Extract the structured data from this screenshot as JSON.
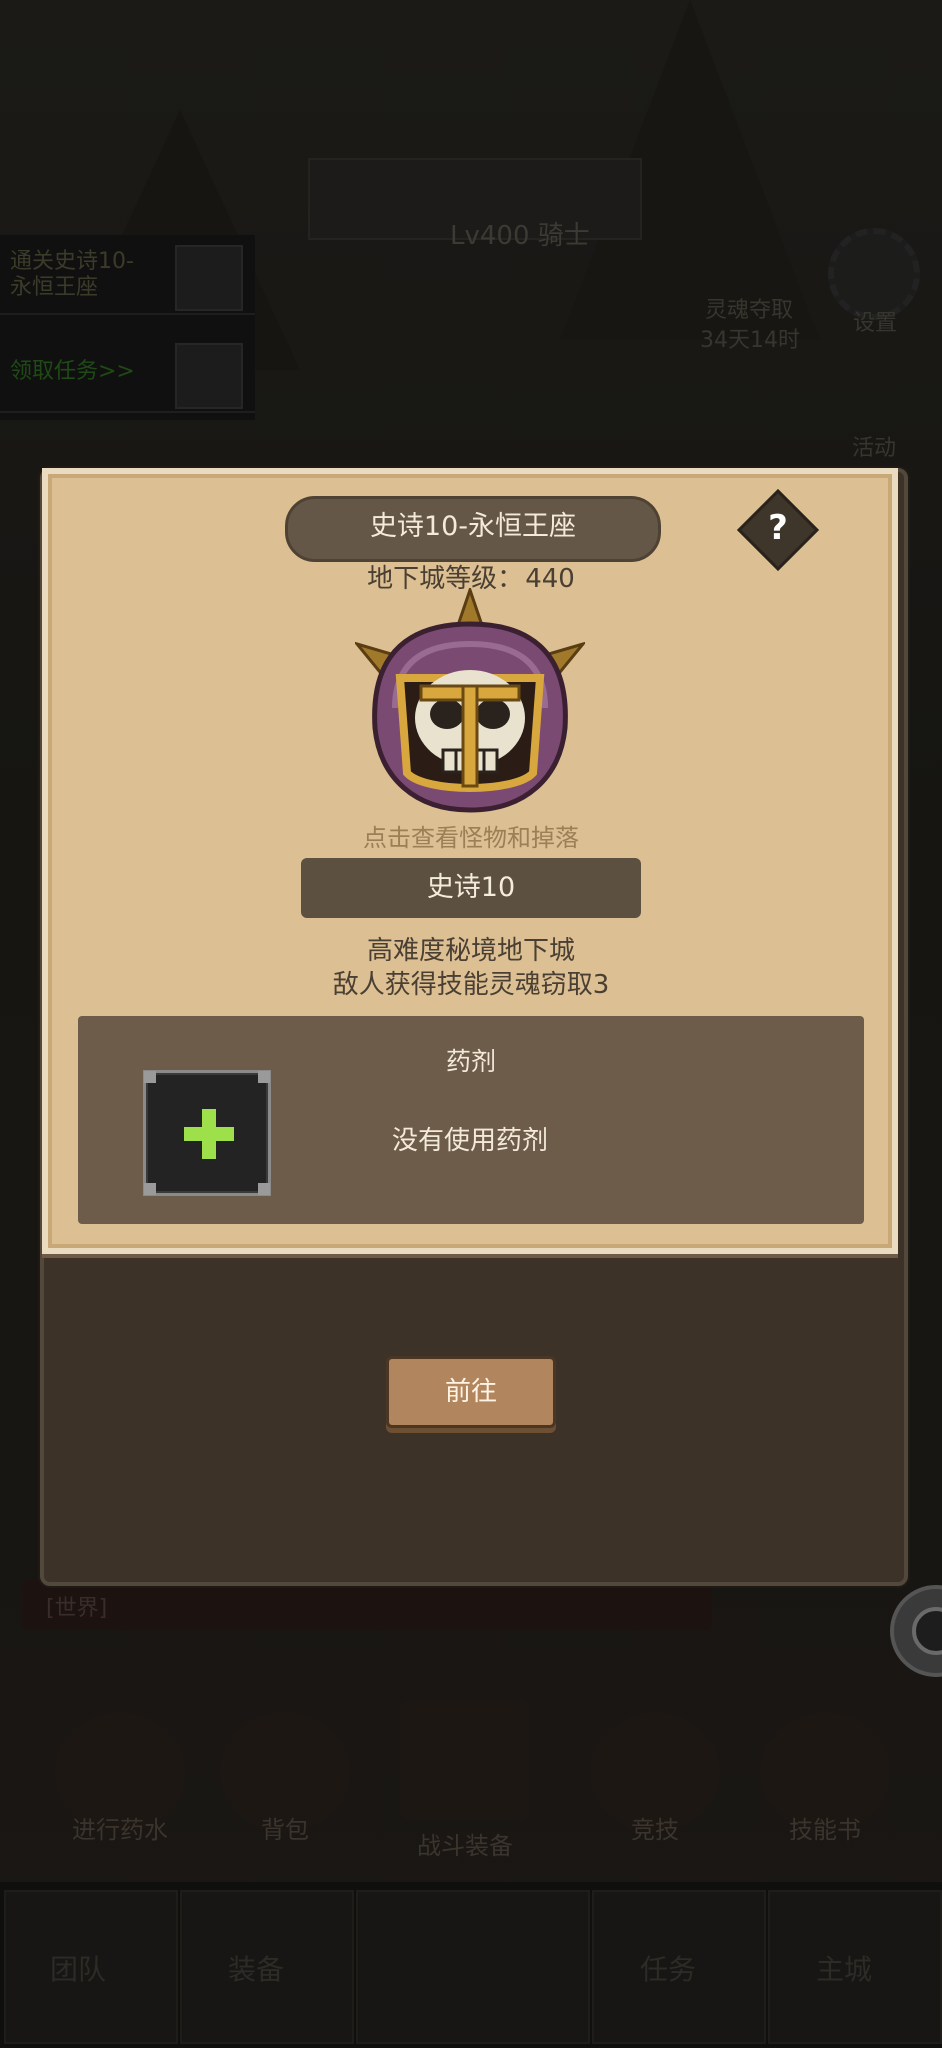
{
  "background": {
    "quest": {
      "line1": "通关史诗10-",
      "line2": "永恒王座",
      "link": "领取任务>>"
    },
    "top_text": "Lv400 骑士",
    "side_labels": {
      "settings": "设置",
      "countdown_title": "灵魂夺取",
      "countdown": "34天14时",
      "activity": "活动"
    },
    "chat_placeholder": "[世界]",
    "icons": [
      "进行药水",
      "背包",
      "战斗装备",
      "竞技",
      "技能书"
    ],
    "nav": [
      "团队",
      "装备",
      "",
      "任务",
      "主城"
    ]
  },
  "modal": {
    "title": "史诗10-永恒王座",
    "help_label": "?",
    "level_label": "地下城等级：",
    "level_value": "440",
    "boss_icon": "skull-helmet-icon",
    "hint": "点击查看怪物和掉落",
    "difficulty_button": "史诗10",
    "desc_line1": "高难度秘境地下城",
    "desc_line2": "敌人获得技能灵魂窃取3",
    "potion": {
      "title": "药剂",
      "status": "没有使用药剂",
      "add_icon": "plus-icon"
    },
    "go_button": "前往"
  },
  "colors": {
    "parchment": "#dcbf92",
    "panel": "#6d5c49",
    "banner": "#655747",
    "plus": "#9ee04a",
    "button": "#b1865e"
  }
}
